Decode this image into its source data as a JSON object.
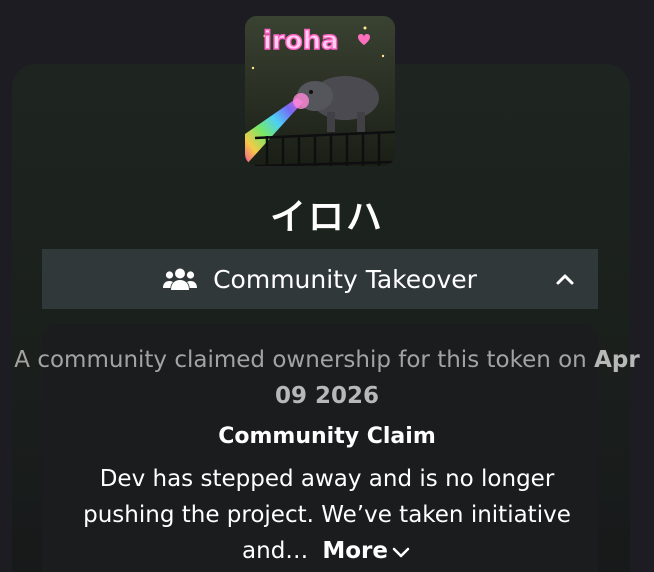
{
  "token": {
    "logo_text": "iroha",
    "name": "イロハ"
  },
  "cto": {
    "icon": "users-icon",
    "label": "Community Takeover",
    "toggle_icon": "chevron-up-icon"
  },
  "claim": {
    "intro_text": "A community claimed ownership for this token on",
    "date": "Apr 09 2026",
    "title": "Community Claim",
    "description": "Dev has stepped away and is no longer pushing the project. We’ve taken initiative and…",
    "more_label": "More",
    "more_icon": "chevron-down-icon"
  },
  "colors": {
    "page_bg": "#1c1c22",
    "card_bg": "#1e2520",
    "bar_bg": "#31383a",
    "panel_bg": "#1b1c1e",
    "muted_text": "#a3a3a3"
  }
}
